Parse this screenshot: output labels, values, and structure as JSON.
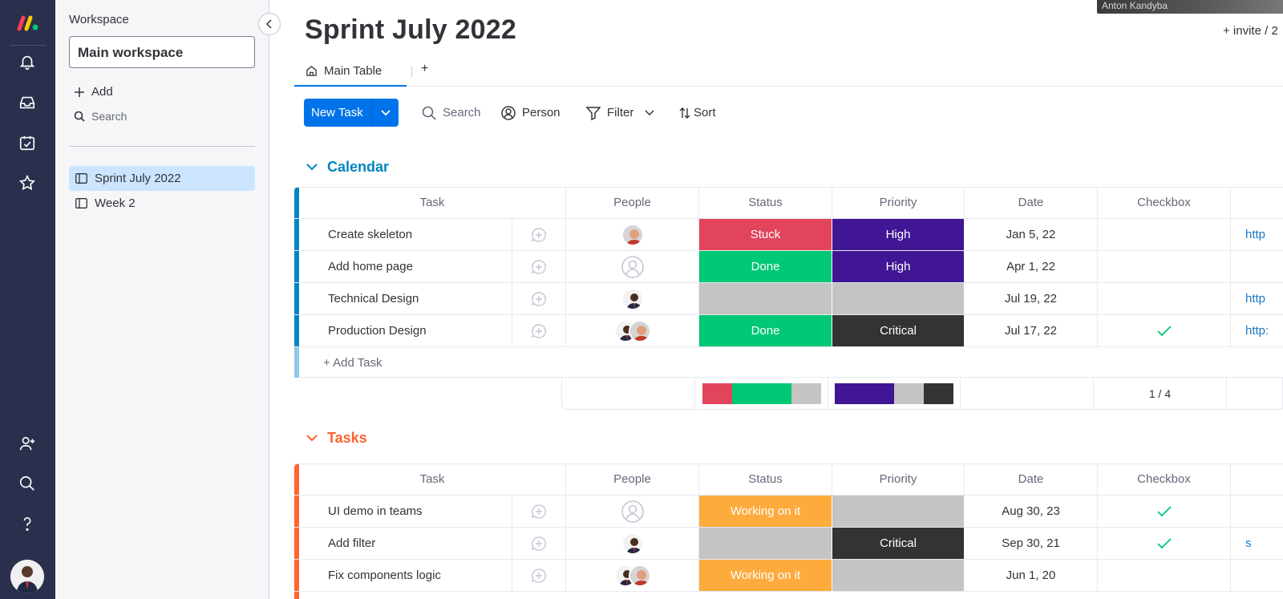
{
  "rail": {
    "icons": [
      "monday-logo-icon",
      "bell-icon",
      "inbox-icon",
      "calendar-check-icon",
      "star-icon",
      "invite-user-icon",
      "search-icon",
      "help-icon",
      "user-avatar"
    ]
  },
  "workspace": {
    "label": "Workspace",
    "selected": "Main workspace",
    "add_label": "Add",
    "search_label": "Search",
    "boards": [
      {
        "name": "Sprint July 2022",
        "active": true
      },
      {
        "name": "Week 2",
        "active": false
      }
    ]
  },
  "video": {
    "name": "Anton Kandyba"
  },
  "header": {
    "title": "Sprint July 2022",
    "invite": "+ invite / 2",
    "tab_main": "Main Table",
    "tab_add": "+"
  },
  "toolbar": {
    "new_task": "New Task",
    "search": "Search",
    "person": "Person",
    "filter": "Filter",
    "sort": "Sort"
  },
  "columns": [
    "Task",
    "People",
    "Status",
    "Priority",
    "Date",
    "Checkbox"
  ],
  "colors": {
    "stuck": "#e2445c",
    "done": "#00c875",
    "high": "#401694",
    "critical": "#333333",
    "working": "#fdab3d",
    "empty": "#c4c4c4",
    "calendar_group": "#0086c0",
    "tasks_group": "#ff642e"
  },
  "groups": [
    {
      "name": "Calendar",
      "add_task": "+ Add Task",
      "checkbox_summary": "1 / 4",
      "rows": [
        {
          "task": "Create skeleton",
          "status": "Stuck",
          "priority": "High",
          "date": "Jan 5, 22",
          "checked": false,
          "link": "http"
        },
        {
          "task": "Add home page",
          "status": "Done",
          "priority": "High",
          "date": "Apr 1, 22",
          "checked": false,
          "link": ""
        },
        {
          "task": "Technical Design",
          "status": "",
          "priority": "",
          "date": "Jul 19, 22",
          "checked": false,
          "link": "http"
        },
        {
          "task": "Production Design",
          "status": "Done",
          "priority": "Critical",
          "date": "Jul 17, 22",
          "checked": true,
          "link": "http:"
        }
      ]
    },
    {
      "name": "Tasks",
      "rows": [
        {
          "task": "UI demo in teams",
          "status": "Working on it",
          "priority": "",
          "date": "Aug 30, 23",
          "checked": true,
          "link": ""
        },
        {
          "task": "Add filter",
          "status": "",
          "priority": "Critical",
          "date": "Sep 30, 21",
          "checked": true,
          "link": "s"
        },
        {
          "task": "Fix components logic",
          "status": "Working on it",
          "priority": "",
          "date": "Jun 1, 20",
          "checked": false,
          "link": ""
        }
      ]
    }
  ]
}
